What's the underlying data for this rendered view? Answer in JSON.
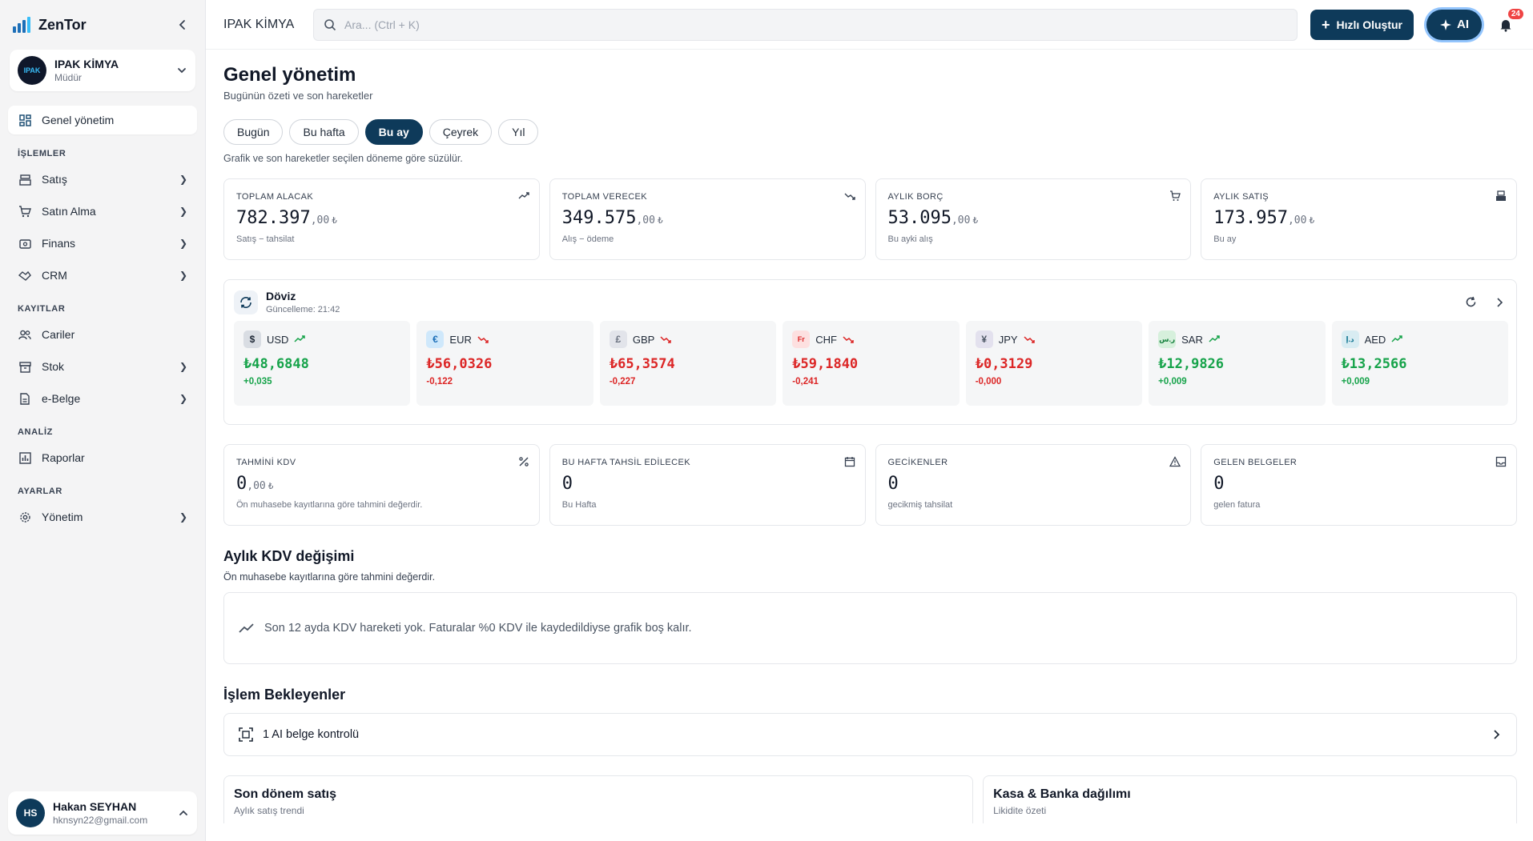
{
  "brand": {
    "name": "ZenTor"
  },
  "company": {
    "name": "IPAK KİMYA",
    "role": "Müdür",
    "logo_text": "IPAK"
  },
  "nav": {
    "home": "Genel yönetim",
    "sections": {
      "islemler": "İŞLEMLER",
      "kayitlar": "KAYITLAR",
      "analiz": "ANALİZ",
      "ayarlar": "AYARLAR"
    },
    "items": {
      "satis": "Satış",
      "satin_alma": "Satın Alma",
      "finans": "Finans",
      "crm": "CRM",
      "cariler": "Cariler",
      "stok": "Stok",
      "ebelge": "e-Belge",
      "raporlar": "Raporlar",
      "yonetim": "Yönetim"
    }
  },
  "user": {
    "initials": "HS",
    "name": "Hakan SEYHAN",
    "email": "hknsyn22@gmail.com"
  },
  "topbar": {
    "title": "IPAK KİMYA",
    "search_placeholder": "Ara... (Ctrl + K)",
    "quick_create": "Hızlı Oluştur",
    "ai": "AI",
    "notifications": "24"
  },
  "page": {
    "title": "Genel yönetim",
    "subtitle": "Bugünün özeti ve son hareketler",
    "periods": [
      "Bugün",
      "Bu hafta",
      "Bu ay",
      "Çeyrek",
      "Yıl"
    ],
    "active_period": "Bu ay",
    "periods_note": "Grafik ve son hareketler seçilen döneme göre süzülür."
  },
  "stats": [
    {
      "label": "TOPLAM ALACAK",
      "int": "782.397",
      "dec": ",00",
      "cur": "₺",
      "sub": "Satış − tahsilat",
      "icon": "trend-up-icon"
    },
    {
      "label": "TOPLAM VERECEK",
      "int": "349.575",
      "dec": ",00",
      "cur": "₺",
      "sub": "Alış − ödeme",
      "icon": "trend-down-icon"
    },
    {
      "label": "AYLIK BORÇ",
      "int": "53.095",
      "dec": ",00",
      "cur": "₺",
      "sub": "Bu ayki alış",
      "icon": "cart-icon"
    },
    {
      "label": "AYLIK SATIŞ",
      "int": "173.957",
      "dec": ",00",
      "cur": "₺",
      "sub": "Bu ay",
      "icon": "register-icon"
    }
  ],
  "doviz": {
    "title": "Döviz",
    "updated": "Güncelleme: 21:42",
    "rates": [
      {
        "code": "USD",
        "symbol": "$",
        "value": "₺48,6848",
        "change": "+0,035",
        "dir": "up",
        "badge_bg": "#d9dde3",
        "badge_fg": "#1f2937"
      },
      {
        "code": "EUR",
        "symbol": "€",
        "value": "₺56,0326",
        "change": "-0,122",
        "dir": "down",
        "badge_bg": "#cfe8fb",
        "badge_fg": "#1d6fb8"
      },
      {
        "code": "GBP",
        "symbol": "£",
        "value": "₺65,3574",
        "change": "-0,227",
        "dir": "down",
        "badge_bg": "#e2e4ea",
        "badge_fg": "#6b7280"
      },
      {
        "code": "CHF",
        "symbol": "Fr",
        "value": "₺59,1840",
        "change": "-0,241",
        "dir": "down",
        "badge_bg": "#fde0e0",
        "badge_fg": "#dc2626"
      },
      {
        "code": "JPY",
        "symbol": "¥",
        "value": "₺0,3129",
        "change": "-0,000",
        "dir": "down",
        "badge_bg": "#e3e1ee",
        "badge_fg": "#4b5563"
      },
      {
        "code": "SAR",
        "symbol": "ر.س",
        "value": "₺12,9826",
        "change": "+0,009",
        "dir": "up",
        "badge_bg": "#d6f0dc",
        "badge_fg": "#15803d"
      },
      {
        "code": "AED",
        "symbol": "د.إ",
        "value": "₺13,2566",
        "change": "+0,009",
        "dir": "up",
        "badge_bg": "#d8ecf2",
        "badge_fg": "#0e7490"
      }
    ]
  },
  "stats2": [
    {
      "label": "TAHMİNİ KDV",
      "int": "0",
      "dec": ",00",
      "cur": "₺",
      "sub": "Ön muhasebe kayıtlarına göre tahmini değerdir.",
      "icon": "percent-icon"
    },
    {
      "label": "BU HAFTA TAHSİL EDİLECEK",
      "int": "0",
      "dec": "",
      "cur": "",
      "sub": "Bu Hafta",
      "icon": "calendar-icon"
    },
    {
      "label": "GECİKENLER",
      "int": "0",
      "dec": "",
      "cur": "",
      "sub": "gecikmiş tahsilat",
      "icon": "warning-icon"
    },
    {
      "label": "GELEN BELGELER",
      "int": "0",
      "dec": "",
      "cur": "",
      "sub": "gelen fatura",
      "icon": "inbox-icon"
    }
  ],
  "kdv": {
    "title": "Aylık KDV değişimi",
    "subtitle": "Ön muhasebe kayıtlarına göre tahmini değerdir.",
    "empty": "Son 12 ayda KDV hareketi yok. Faturalar %0 KDV ile kaydedildiyse grafik boş kalır."
  },
  "pending": {
    "title": "İşlem Bekleyenler",
    "item": "1 AI belge kontrolü"
  },
  "bottom": [
    {
      "title": "Son dönem satış",
      "sub": "Aylık satış trendi"
    },
    {
      "title": "Kasa & Banka dağılımı",
      "sub": "Likidite özeti"
    }
  ],
  "colors": {
    "primary": "#0e3a5a",
    "up": "#16a34a",
    "down": "#dc2626",
    "brand": "#1d6fb8"
  }
}
